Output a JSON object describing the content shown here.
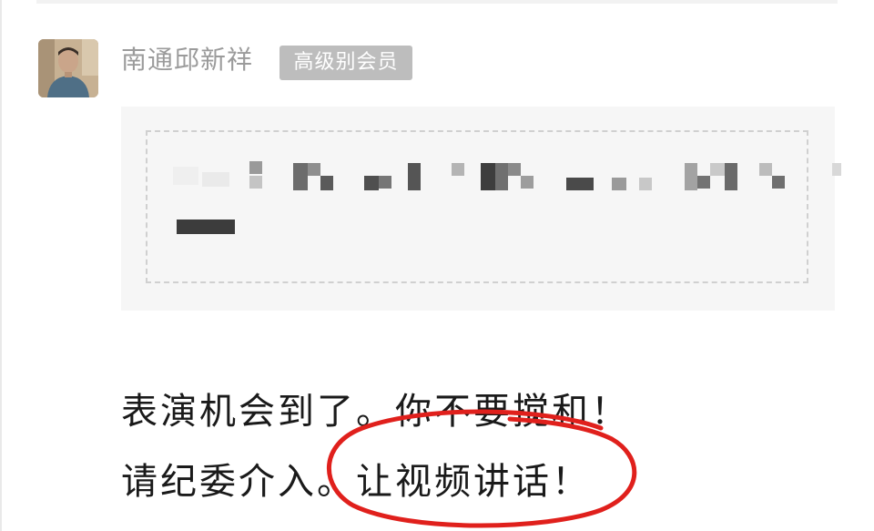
{
  "comment": {
    "author_name": "南通邱新祥",
    "member_badge": "高级别会员",
    "message_lines": [
      "表演机会到了。你不要搅和！",
      "请纪委介入。让视频讲话！"
    ]
  },
  "icons": {
    "avatar": "user-photo-avatar"
  },
  "colors": {
    "author_name": "#9b9b9b",
    "badge_bg": "#bdbdbd",
    "quote_bg": "#f6f6f6",
    "annotation_circle": "#e0201c"
  }
}
